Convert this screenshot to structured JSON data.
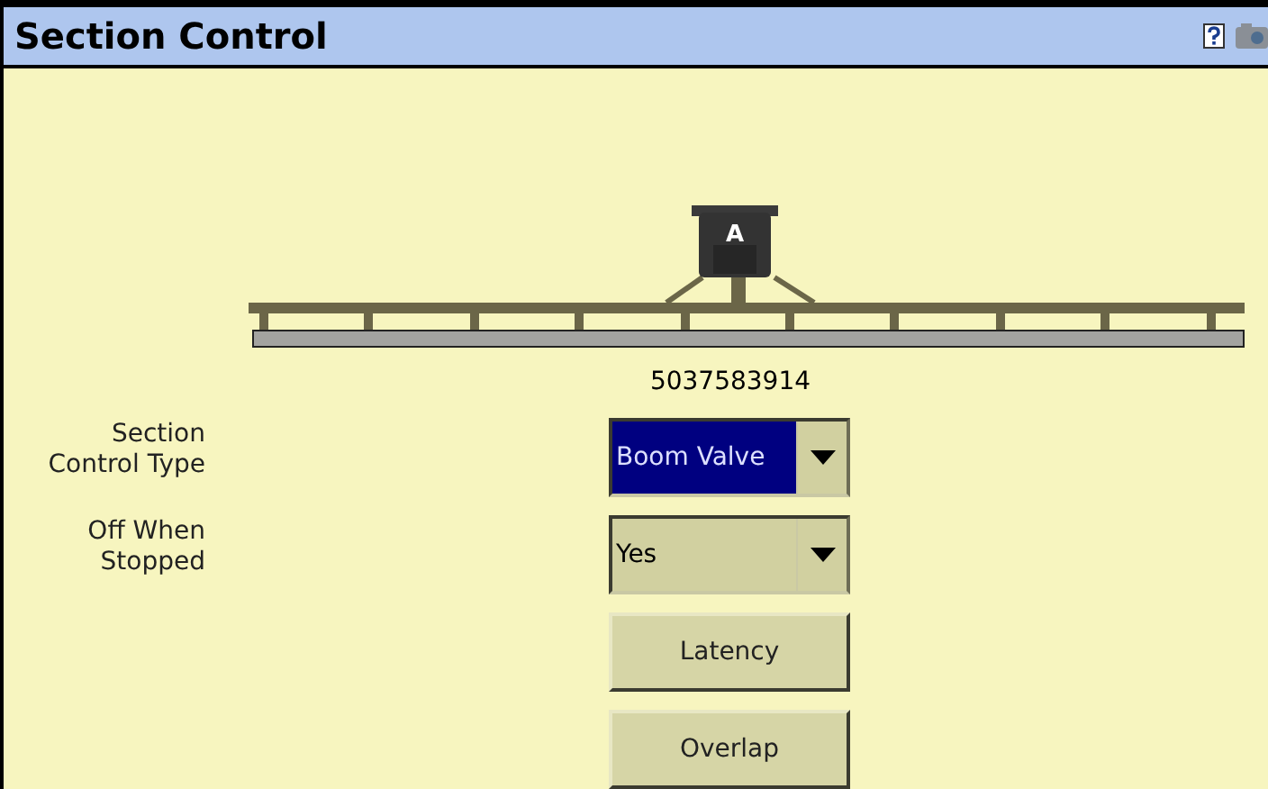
{
  "window": {
    "title": "Section Control"
  },
  "boom": {
    "tank_label": "A",
    "serial": "5037583914"
  },
  "settings": [
    {
      "kind": "dropdown",
      "label": "Section Control Type",
      "value": "Boom Valve",
      "selected": true
    },
    {
      "kind": "dropdown",
      "label": "Off When Stopped",
      "value": "Yes",
      "selected": false
    },
    {
      "kind": "button",
      "value": "Latency"
    },
    {
      "kind": "button",
      "value": "Overlap"
    }
  ]
}
